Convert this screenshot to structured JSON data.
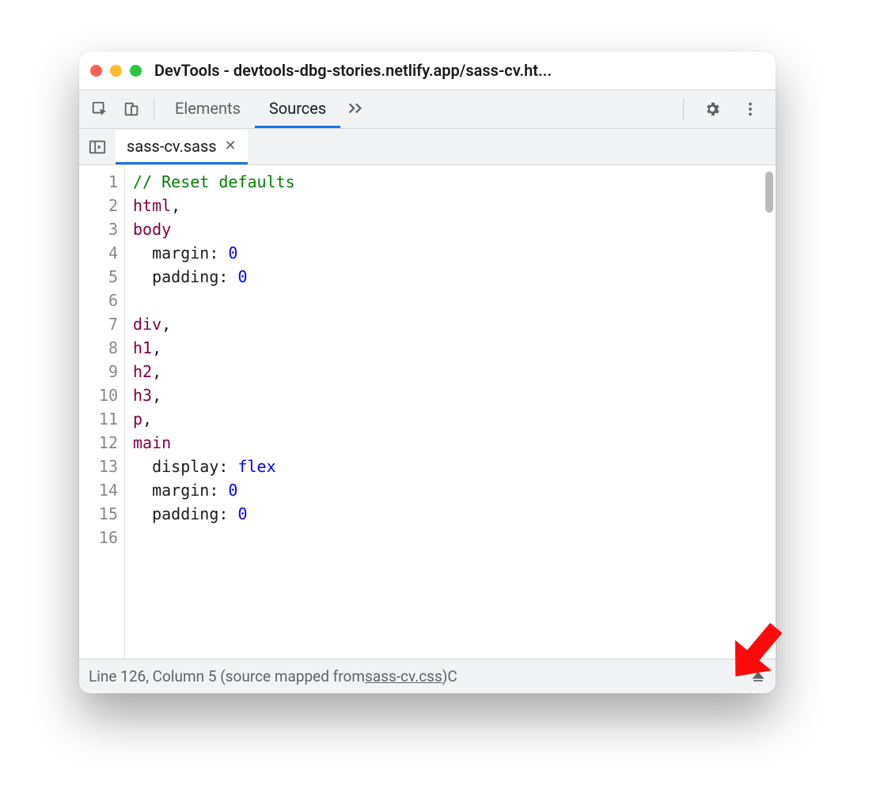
{
  "window": {
    "title": "DevTools - devtools-dbg-stories.netlify.app/sass-cv.ht..."
  },
  "toolbar": {
    "tabs": [
      {
        "label": "Elements",
        "active": false
      },
      {
        "label": "Sources",
        "active": true
      }
    ]
  },
  "file_tab": {
    "name": "sass-cv.sass"
  },
  "code": {
    "lines": [
      {
        "n": 1,
        "tokens": [
          {
            "t": "// Reset defaults",
            "c": "comment"
          }
        ]
      },
      {
        "n": 2,
        "tokens": [
          {
            "t": "html",
            "c": "selector"
          },
          {
            "t": ",",
            "c": "plain"
          }
        ]
      },
      {
        "n": 3,
        "tokens": [
          {
            "t": "body",
            "c": "selector"
          }
        ]
      },
      {
        "n": 4,
        "tokens": [
          {
            "t": "  margin: ",
            "c": "plain"
          },
          {
            "t": "0",
            "c": "number"
          }
        ]
      },
      {
        "n": 5,
        "tokens": [
          {
            "t": "  padding: ",
            "c": "plain"
          },
          {
            "t": "0",
            "c": "number"
          }
        ]
      },
      {
        "n": 6,
        "tokens": [
          {
            "t": "",
            "c": "plain"
          }
        ]
      },
      {
        "n": 7,
        "tokens": [
          {
            "t": "div",
            "c": "selector"
          },
          {
            "t": ",",
            "c": "plain"
          }
        ]
      },
      {
        "n": 8,
        "tokens": [
          {
            "t": "h1",
            "c": "selector"
          },
          {
            "t": ",",
            "c": "plain"
          }
        ]
      },
      {
        "n": 9,
        "tokens": [
          {
            "t": "h2",
            "c": "selector"
          },
          {
            "t": ",",
            "c": "plain"
          }
        ]
      },
      {
        "n": 10,
        "tokens": [
          {
            "t": "h3",
            "c": "selector"
          },
          {
            "t": ",",
            "c": "plain"
          }
        ]
      },
      {
        "n": 11,
        "tokens": [
          {
            "t": "p",
            "c": "selector"
          },
          {
            "t": ",",
            "c": "plain"
          }
        ]
      },
      {
        "n": 12,
        "tokens": [
          {
            "t": "main",
            "c": "selector"
          }
        ]
      },
      {
        "n": 13,
        "tokens": [
          {
            "t": "  display: ",
            "c": "plain"
          },
          {
            "t": "flex",
            "c": "value"
          }
        ]
      },
      {
        "n": 14,
        "tokens": [
          {
            "t": "  margin: ",
            "c": "plain"
          },
          {
            "t": "0",
            "c": "number"
          }
        ]
      },
      {
        "n": 15,
        "tokens": [
          {
            "t": "  padding: ",
            "c": "plain"
          },
          {
            "t": "0",
            "c": "number"
          }
        ]
      },
      {
        "n": 16,
        "tokens": [
          {
            "t": "",
            "c": "plain"
          }
        ]
      }
    ]
  },
  "status": {
    "line_label": "Line",
    "line": 126,
    "column_label": "Column",
    "column": 5,
    "mapped_prefix": "(source mapped from ",
    "mapped_file": "sass-cv.css",
    "mapped_suffix": ")",
    "trailing": " C"
  }
}
